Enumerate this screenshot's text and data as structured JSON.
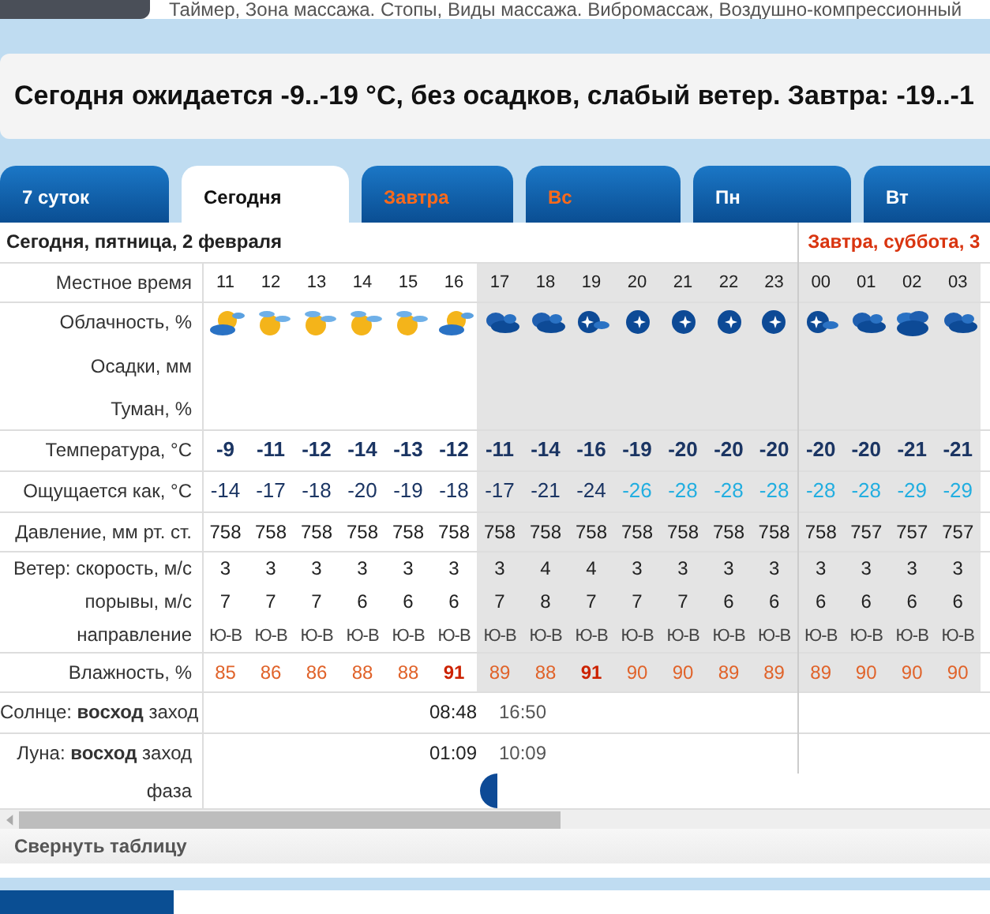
{
  "top_snippet": "Таймер, Зона массажа. Стопы, Виды массажа. Вибромассаж, Воздушно-компрессионный",
  "summary": "Сегодня ожидается -9..-19 °C, без осадков, слабый ветер. Завтра: -19..-1",
  "tabs": [
    {
      "label": "7 суток",
      "selected": false,
      "weekend": false
    },
    {
      "label": "Сегодня",
      "selected": true,
      "weekend": false
    },
    {
      "label": "Завтра",
      "selected": false,
      "weekend": true
    },
    {
      "label": "Вс",
      "selected": false,
      "weekend": true
    },
    {
      "label": "Пн",
      "selected": false,
      "weekend": false
    },
    {
      "label": "Вт",
      "selected": false,
      "weekend": false
    }
  ],
  "row_labels": {
    "time": "Местное время",
    "clouds": "Облачность, %",
    "precip": "Осадки, мм",
    "fog": "Туман, %",
    "temp": "Температура, °C",
    "feels": "Ощущается как, °C",
    "pressure": "Давление, мм рт. ст.",
    "wind": "Ветер: скорость, м/с",
    "gust": "порывы, м/с",
    "direction": "направление",
    "humidity": "Влажность, %",
    "sun": "Солнце: **восход** заход",
    "moon": "Луна: **восход** заход",
    "phase": "фаза"
  },
  "days": [
    {
      "title": "Сегодня, пятница, 2 февраля",
      "weekend": false,
      "hours": [
        {
          "hour": "11",
          "night": false,
          "kind": "partly_cloudy",
          "temp": "-9",
          "feels": "-14",
          "cold": false,
          "pressure": "758",
          "wind": "3",
          "gust": "7",
          "direction": "Ю-В",
          "humidity": "85",
          "peak": false
        },
        {
          "hour": "12",
          "night": false,
          "kind": "mostly_sunny",
          "temp": "-11",
          "feels": "-17",
          "cold": false,
          "pressure": "758",
          "wind": "3",
          "gust": "7",
          "direction": "Ю-В",
          "humidity": "86",
          "peak": false
        },
        {
          "hour": "13",
          "night": false,
          "kind": "mostly_sunny",
          "temp": "-12",
          "feels": "-18",
          "cold": false,
          "pressure": "758",
          "wind": "3",
          "gust": "7",
          "direction": "Ю-В",
          "humidity": "86",
          "peak": false
        },
        {
          "hour": "14",
          "night": false,
          "kind": "mostly_sunny",
          "temp": "-14",
          "feels": "-20",
          "cold": false,
          "pressure": "758",
          "wind": "3",
          "gust": "6",
          "direction": "Ю-В",
          "humidity": "88",
          "peak": false
        },
        {
          "hour": "15",
          "night": false,
          "kind": "mostly_sunny",
          "temp": "-13",
          "feels": "-19",
          "cold": false,
          "pressure": "758",
          "wind": "3",
          "gust": "6",
          "direction": "Ю-В",
          "humidity": "88",
          "peak": false
        },
        {
          "hour": "16",
          "night": false,
          "kind": "partly_cloudy",
          "temp": "-12",
          "feels": "-18",
          "cold": false,
          "pressure": "758",
          "wind": "3",
          "gust": "6",
          "direction": "Ю-В",
          "humidity": "91",
          "peak": true
        },
        {
          "hour": "17",
          "night": true,
          "kind": "cloudy_night",
          "temp": "-11",
          "feels": "-17",
          "cold": false,
          "pressure": "758",
          "wind": "3",
          "gust": "7",
          "direction": "Ю-В",
          "humidity": "89",
          "peak": false
        },
        {
          "hour": "18",
          "night": true,
          "kind": "cloudy_night",
          "temp": "-14",
          "feels": "-21",
          "cold": false,
          "pressure": "758",
          "wind": "4",
          "gust": "8",
          "direction": "Ю-В",
          "humidity": "88",
          "peak": false
        },
        {
          "hour": "19",
          "night": true,
          "kind": "moon_cloud",
          "temp": "-16",
          "feels": "-24",
          "cold": false,
          "pressure": "758",
          "wind": "4",
          "gust": "7",
          "direction": "Ю-В",
          "humidity": "91",
          "peak": true
        },
        {
          "hour": "20",
          "night": true,
          "kind": "clear_night",
          "temp": "-19",
          "feels": "-26",
          "cold": true,
          "pressure": "758",
          "wind": "3",
          "gust": "7",
          "direction": "Ю-В",
          "humidity": "90",
          "peak": false
        },
        {
          "hour": "21",
          "night": true,
          "kind": "clear_night",
          "temp": "-20",
          "feels": "-28",
          "cold": true,
          "pressure": "758",
          "wind": "3",
          "gust": "7",
          "direction": "Ю-В",
          "humidity": "90",
          "peak": false
        },
        {
          "hour": "22",
          "night": true,
          "kind": "clear_night",
          "temp": "-20",
          "feels": "-28",
          "cold": true,
          "pressure": "758",
          "wind": "3",
          "gust": "6",
          "direction": "Ю-В",
          "humidity": "89",
          "peak": false
        },
        {
          "hour": "23",
          "night": true,
          "kind": "clear_night",
          "temp": "-20",
          "feels": "-28",
          "cold": true,
          "pressure": "758",
          "wind": "3",
          "gust": "6",
          "direction": "Ю-В",
          "humidity": "89",
          "peak": false
        }
      ],
      "sun": {
        "rise": "08:48",
        "set": "16:50"
      },
      "moon": {
        "rise": "01:09",
        "set": "10:09"
      }
    },
    {
      "title": "Завтра, суббота, 3",
      "weekend": true,
      "hours": [
        {
          "hour": "00",
          "night": true,
          "kind": "moon_cloud",
          "temp": "-20",
          "feels": "-28",
          "cold": true,
          "pressure": "758",
          "wind": "3",
          "gust": "6",
          "direction": "Ю-В",
          "humidity": "89",
          "peak": false
        },
        {
          "hour": "01",
          "night": true,
          "kind": "cloudy_night",
          "temp": "-20",
          "feels": "-28",
          "cold": true,
          "pressure": "757",
          "wind": "3",
          "gust": "6",
          "direction": "Ю-В",
          "humidity": "90",
          "peak": false
        },
        {
          "hour": "02",
          "night": true,
          "kind": "overcast",
          "temp": "-21",
          "feels": "-29",
          "cold": true,
          "pressure": "757",
          "wind": "3",
          "gust": "6",
          "direction": "Ю-В",
          "humidity": "90",
          "peak": false
        },
        {
          "hour": "03",
          "night": true,
          "kind": "cloudy_night",
          "temp": "-21",
          "feels": "-29",
          "cold": true,
          "pressure": "757",
          "wind": "3",
          "gust": "6",
          "direction": "Ю-В",
          "humidity": "90",
          "peak": false
        }
      ]
    }
  ],
  "collapse_link": "Свернуть таблицу"
}
